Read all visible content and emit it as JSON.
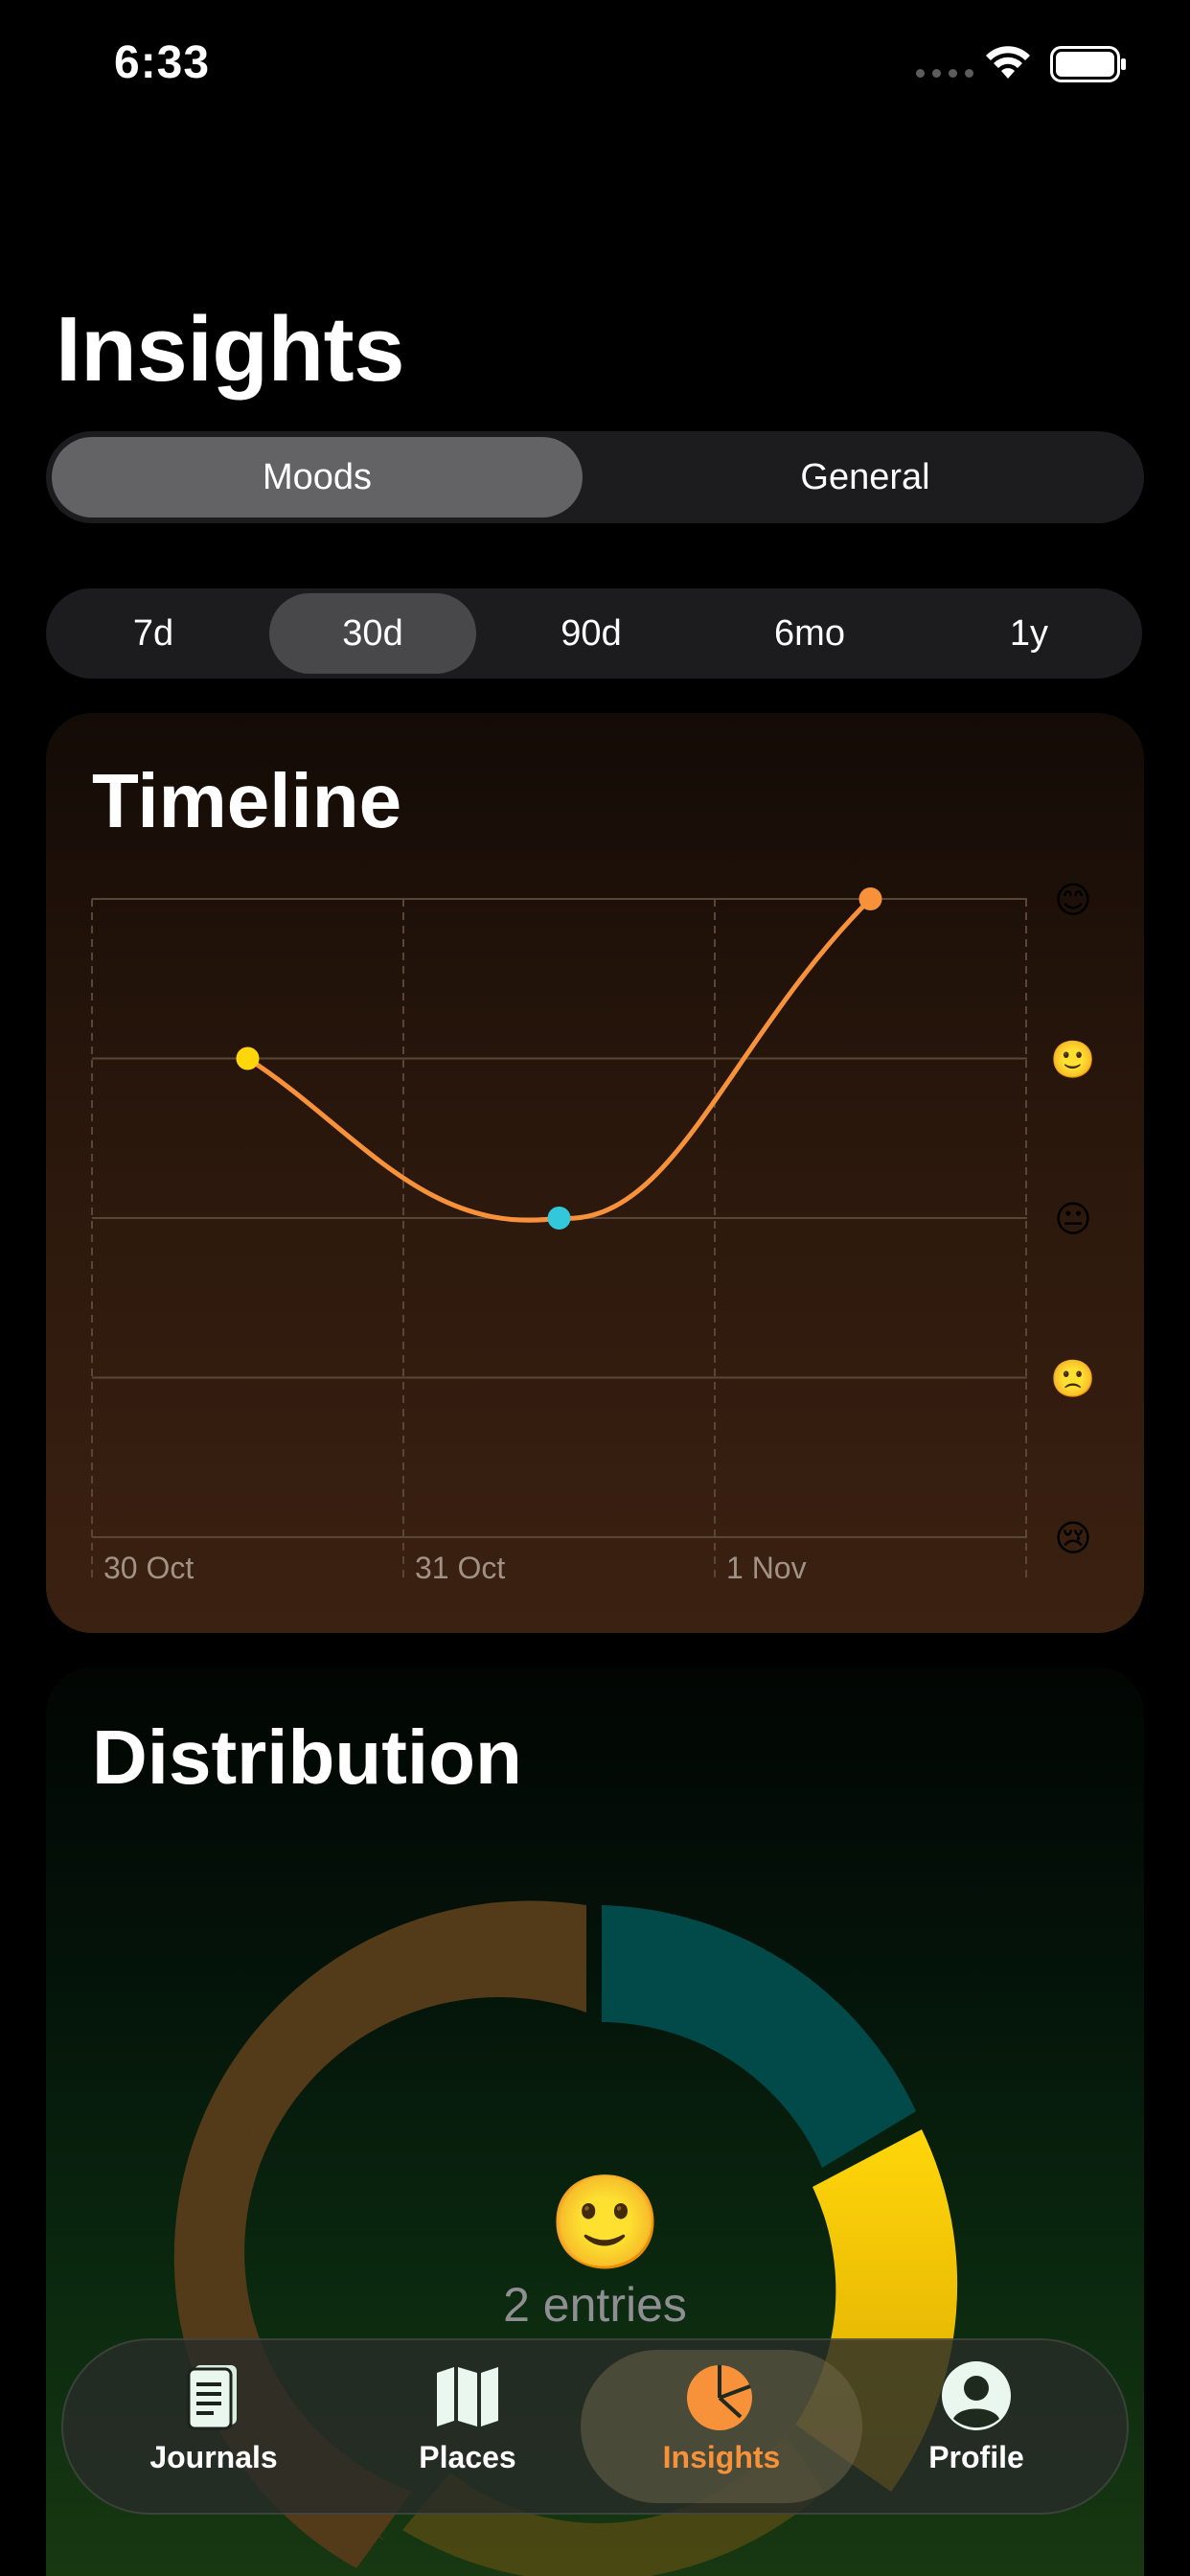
{
  "status_bar": {
    "time": "6:33"
  },
  "page": {
    "title": "Insights"
  },
  "segment_tabs": {
    "items": [
      "Moods",
      "General"
    ],
    "selected": "Moods"
  },
  "range_tabs": {
    "items": [
      "7d",
      "30d",
      "90d",
      "6mo",
      "1y"
    ],
    "selected": "30d"
  },
  "timeline": {
    "title": "Timeline",
    "mood_levels": [
      "😊",
      "🙂",
      "😐",
      "🙁",
      "😢"
    ],
    "x_labels": [
      "30 Oct",
      "31 Oct",
      "1 Nov"
    ],
    "line_color": "#f7923a"
  },
  "chart_data": {
    "type": "line",
    "x": [
      "30 Oct",
      "31 Oct",
      "1 Nov"
    ],
    "series": [
      {
        "values": [
          4,
          3,
          5
        ]
      }
    ],
    "point_colors": [
      "#ffd60a",
      "#32c8dc",
      "#f7923a"
    ],
    "ylim": [
      1,
      5
    ],
    "y_tick_labels": [
      "😢",
      "🙁",
      "😐",
      "🙂",
      "😊"
    ],
    "grid": true
  },
  "distribution": {
    "title": "Distribution",
    "center_emoji": "🙂",
    "entries_label": "2 entries"
  },
  "tab_bar": {
    "items": [
      {
        "label": "Journals",
        "icon": "journal-icon"
      },
      {
        "label": "Places",
        "icon": "map-icon"
      },
      {
        "label": "Insights",
        "icon": "pie-chart-icon"
      },
      {
        "label": "Profile",
        "icon": "person-icon"
      }
    ],
    "active": "Insights",
    "accent": "#f7923a"
  }
}
